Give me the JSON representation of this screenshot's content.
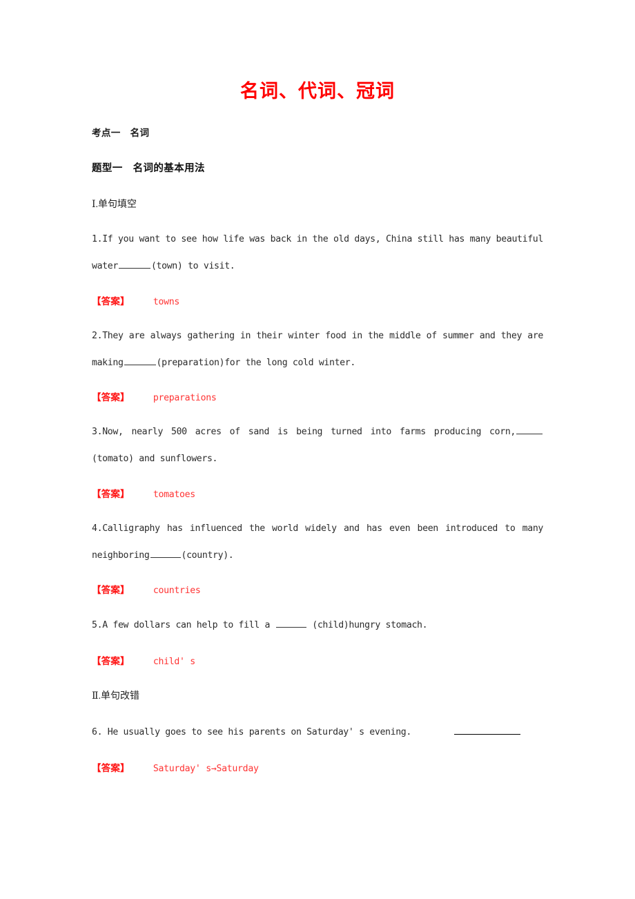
{
  "document": {
    "title": "名词、代词、冠词",
    "title_color": "#ff0000",
    "answer_color": "#ff3333",
    "body_color": "#2b2b2b"
  },
  "sections": {
    "kaodian": "考点一　名词",
    "tixing": "题型一　名词的基本用法",
    "sub_fill": "Ⅰ.单句填空",
    "sub_correct": "Ⅱ.单句改错"
  },
  "answer_label": "【答案】",
  "questions": [
    {
      "number": "1.",
      "part_a": "If you want to see how life was back in the old days, China still has many beautiful water",
      "part_b": "(town) to visit.",
      "answer": "towns"
    },
    {
      "number": "2.",
      "part_a": "They are always gathering in their winter food in the middle of summer and they are making",
      "part_b": "(preparation)for the long cold winter.",
      "answer": "preparations"
    },
    {
      "number": "3.",
      "part_a": "Now, nearly 500 acres of sand is being turned into farms producing corn,",
      "part_b": "(tomato) and sunflowers.",
      "answer": "tomatoes"
    },
    {
      "number": "4.",
      "part_a": "Calligraphy has influenced the world widely and has even been introduced to many neighboring",
      "part_b": "(country).",
      "answer": "countries"
    },
    {
      "number": "5.",
      "part_a": "A few dollars can help to fill a",
      "part_b": "(child)hungry stomach.",
      "answer": "child' s"
    },
    {
      "number": "6.",
      "part_a": "He usually goes to see his parents on Saturday' s evening.",
      "part_b": "",
      "answer": "Saturday' s→Saturday"
    }
  ]
}
